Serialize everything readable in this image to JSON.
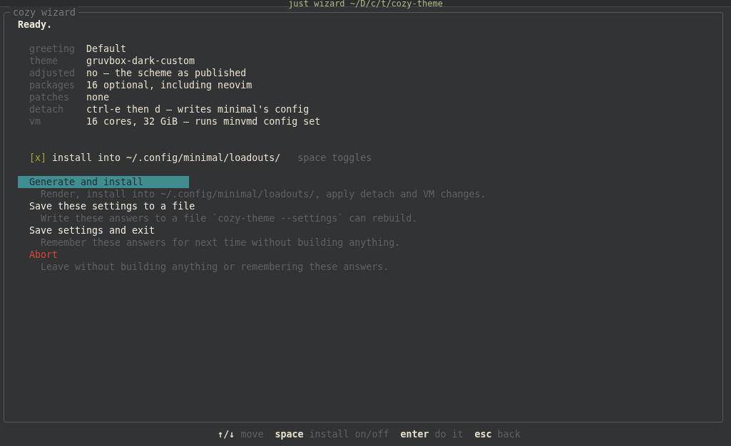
{
  "window": {
    "title": "just wizard ~/D/c/t/cozy-theme"
  },
  "panel": {
    "title": "cozy wizard",
    "status": "Ready.",
    "fields": [
      {
        "label": "greeting",
        "value": "Default"
      },
      {
        "label": "theme",
        "value": "gruvbox-dark-custom"
      },
      {
        "label": "adjusted",
        "value": "no — the scheme as published"
      },
      {
        "label": "packages",
        "value": "16 optional, including neovim"
      },
      {
        "label": "patches",
        "value": "none"
      },
      {
        "label": "detach",
        "value": "ctrl-e then d — writes minimal's config"
      },
      {
        "label": "vm",
        "value": "16 cores, 32 GiB — runs minvmd config set"
      }
    ],
    "toggle": {
      "box": "[x]",
      "checked": true,
      "label": "install into ~/.config/minimal/loadouts/",
      "hint": "space toggles"
    },
    "menu": [
      {
        "label": "Generate and install",
        "description": "Render, install into ~/.config/minimal/loadouts/, apply detach and VM changes.",
        "selected": true,
        "kind": "normal"
      },
      {
        "label": "Save these settings to a file",
        "description": "Write these answers to a file `cozy-theme --settings` can rebuild.",
        "selected": false,
        "kind": "normal"
      },
      {
        "label": "Save settings and exit",
        "description": "Remember these answers for next time without building anything.",
        "selected": false,
        "kind": "normal"
      },
      {
        "label": "Abort",
        "description": "Leave without building anything or remembering these answers.",
        "selected": false,
        "kind": "danger"
      }
    ]
  },
  "footer": [
    {
      "key": "↑/↓",
      "action": "move"
    },
    {
      "key": "space",
      "action": "install on/off"
    },
    {
      "key": "enter",
      "action": "do it"
    },
    {
      "key": "esc",
      "action": "back"
    }
  ]
}
